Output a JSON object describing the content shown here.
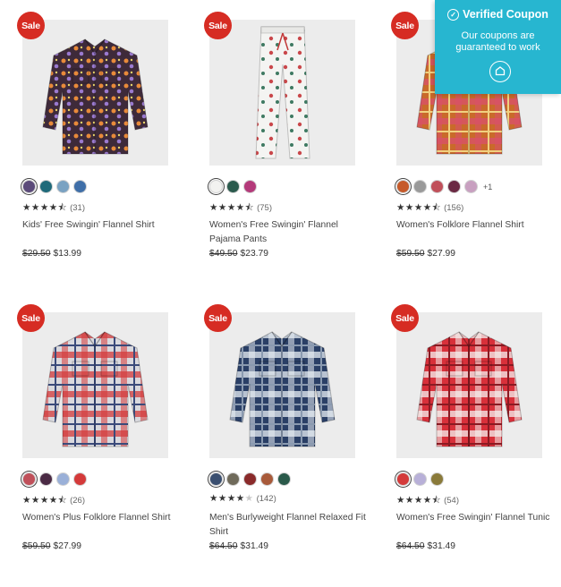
{
  "coupon": {
    "title": "Verified Coupon",
    "text": "Our coupons are guaranteed to work",
    "icon": "shield-check-icon"
  },
  "products": [
    {
      "sale": "Sale",
      "title": "Kids' Free Swingin' Flannel Shirt",
      "rating_count": "(31)",
      "stars": 4.5,
      "old_price": "$29.50",
      "price": "$13.99",
      "swatches": [
        "#5b4a7a",
        "#1f6a7a",
        "#7aa2c2",
        "#3f6fa8"
      ],
      "more": ""
    },
    {
      "sale": "Sale",
      "title": "Women's Free Swingin' Flannel Pajama Pants",
      "rating_count": "(75)",
      "stars": 4.5,
      "old_price": "$49.50",
      "price": "$23.79",
      "swatches": [
        "#f2f2f0",
        "#2b5a4d",
        "#b43a7a"
      ],
      "more": ""
    },
    {
      "sale": "Sale",
      "title": "Women's Folklore Flannel Shirt",
      "rating_count": "(156)",
      "stars": 4.5,
      "old_price": "$59.50",
      "price": "$27.99",
      "swatches": [
        "#c65a2a",
        "#9a9a9a",
        "#c0505a",
        "#6b2a44",
        "#c8a0c0"
      ],
      "more": "+1"
    },
    {
      "sale": "Sale",
      "title": "Women's Plus Folklore Flannel Shirt",
      "rating_count": "(26)",
      "stars": 4.5,
      "old_price": "$59.50",
      "price": "$27.99",
      "swatches": [
        "#c0505a",
        "#4a2a44",
        "#9ab0d8",
        "#d43a3a"
      ],
      "more": ""
    },
    {
      "sale": "Sale",
      "title": "Men's Burlyweight Flannel Relaxed Fit Shirt",
      "rating_count": "(142)",
      "stars": 4,
      "old_price": "$64.50",
      "price": "$31.49",
      "swatches": [
        "#3a4f70",
        "#6f6a5a",
        "#8a2a2a",
        "#a85a3a",
        "#2a5a4a"
      ],
      "more": ""
    },
    {
      "sale": "Sale",
      "title": "Women's Free Swingin' Flannel Tunic",
      "rating_count": "(54)",
      "stars": 4.5,
      "old_price": "$64.50",
      "price": "$31.49",
      "swatches": [
        "#d43a3a",
        "#b8b0d8",
        "#8a7a3a"
      ],
      "more": ""
    }
  ]
}
